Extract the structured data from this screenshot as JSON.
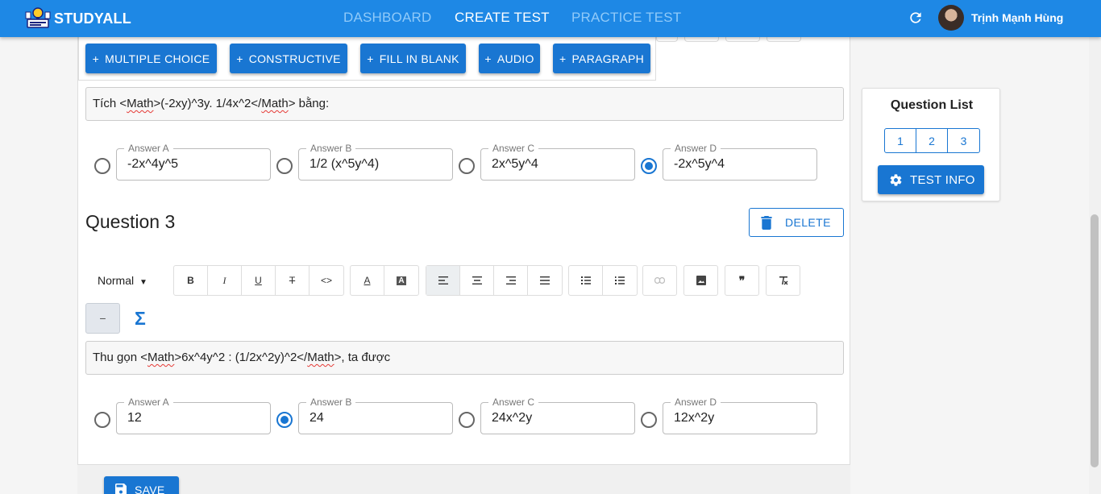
{
  "header": {
    "logo_text": "STUDYALL",
    "nav": [
      "DASHBOARD",
      "CREATE TEST",
      "PRACTICE TEST"
    ],
    "active_nav": "CREATE TEST",
    "user_name": "Trịnh Mạnh Hùng"
  },
  "add_buttons": [
    "MULTIPLE CHOICE",
    "CONSTRUCTIVE",
    "FILL IN BLANK",
    "AUDIO",
    "PARAGRAPH"
  ],
  "question2": {
    "text_pre": "Tích <",
    "text_tag1": "Math",
    "text_mid": ">(-2xy)^3y. 1/4x^2</",
    "text_tag2": "Math",
    "text_post": "> bằng:",
    "answers": [
      {
        "label": "Answer A",
        "value": "-2x^4y^5",
        "selected": false
      },
      {
        "label": "Answer B",
        "value": "1/2 (x^5y^4)",
        "selected": false
      },
      {
        "label": "Answer C",
        "value": "2x^5y^4",
        "selected": false
      },
      {
        "label": "Answer D",
        "value": "-2x^5y^4",
        "selected": true
      }
    ]
  },
  "question3": {
    "title": "Question 3",
    "delete_label": "DELETE",
    "toolbar_format": "Normal",
    "text_pre": "Thu gọn <",
    "text_tag1": "Math",
    "text_mid": ">6x^4y^2 : (1/2x^2y)^2</",
    "text_tag2": "Math",
    "text_post": ">, ta được",
    "answers": [
      {
        "label": "Answer A",
        "value": "12",
        "selected": false
      },
      {
        "label": "Answer B",
        "value": "24",
        "selected": true
      },
      {
        "label": "Answer C",
        "value": "24x^2y",
        "selected": false
      },
      {
        "label": "Answer D",
        "value": "12x^2y",
        "selected": false
      }
    ]
  },
  "save_label": "SAVE",
  "question_list": {
    "title": "Question List",
    "numbers": [
      "1",
      "2",
      "3"
    ],
    "test_info_label": "TEST INFO"
  },
  "colors": {
    "primary": "#1976d2",
    "header": "#1e88e5",
    "nav_inactive": "#90caf9"
  }
}
